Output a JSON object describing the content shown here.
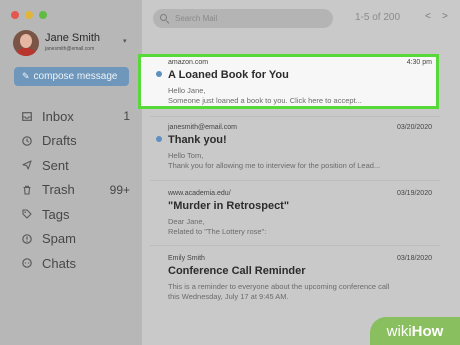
{
  "account": {
    "name": "Jane Smith",
    "email": "janesmith@email.com"
  },
  "compose_label": "compose message",
  "nav": [
    {
      "label": "Inbox",
      "count": "1",
      "icon": "inbox-icon"
    },
    {
      "label": "Drafts",
      "count": "",
      "icon": "drafts-icon"
    },
    {
      "label": "Sent",
      "count": "",
      "icon": "sent-icon"
    },
    {
      "label": "Trash",
      "count": "99+",
      "icon": "trash-icon"
    },
    {
      "label": "Tags",
      "count": "",
      "icon": "tag-icon"
    },
    {
      "label": "Spam",
      "count": "",
      "icon": "spam-icon"
    },
    {
      "label": "Chats",
      "count": "",
      "icon": "chats-icon"
    }
  ],
  "search": {
    "placeholder": "Search Mail"
  },
  "pager": {
    "range": "1-5 of 200",
    "prev": "<",
    "next": ">"
  },
  "emails": [
    {
      "sender": "amazon.com",
      "date": "4:30 pm",
      "subject": "A Loaned Book for You",
      "line1": "Hello Jane,",
      "line2": "Someone just loaned a book to you. Click here to accept...",
      "unread": true
    },
    {
      "sender": "janesmith@email.com",
      "date": "03/20/2020",
      "subject": "Thank you!",
      "line1": "Hello Tom,",
      "line2": "Thank you for allowing me to interview for the position of Lead...",
      "unread": true
    },
    {
      "sender": "www.academia.edu/",
      "date": "03/19/2020",
      "subject": "\"Murder in Retrospect\"",
      "line1": "Dear Jane,",
      "line2": "Related to \"The Lottery rose\":",
      "unread": false
    },
    {
      "sender": "Emily Smith",
      "date": "03/18/2020",
      "subject": "Conference Call Reminder",
      "line1": "This is a reminder to everyone about the upcoming conference call",
      "line2": "this Wednesday, July 17 at 9:45 AM.",
      "unread": false
    }
  ],
  "watermark": {
    "wiki": "wiki",
    "how": "How"
  },
  "colors": {
    "highlight_border": "#58d93a",
    "unread_dot": "#5d8fbf",
    "compose_button": "#6f97bb"
  }
}
